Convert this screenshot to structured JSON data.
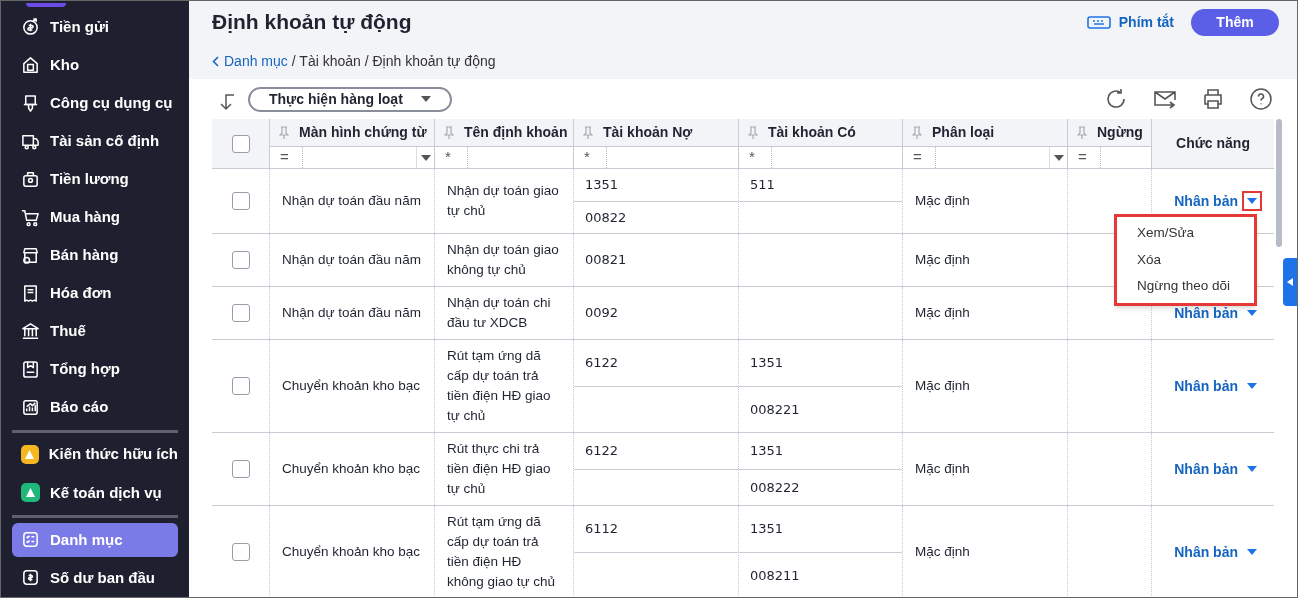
{
  "sidebar": {
    "items": [
      {
        "label": "Tiền gửi",
        "kind": "menu",
        "selected": false
      },
      {
        "label": "Kho",
        "kind": "menu",
        "selected": false
      },
      {
        "label": "Công cụ dụng cụ",
        "kind": "menu",
        "selected": false
      },
      {
        "label": "Tài sản cố định",
        "kind": "menu",
        "selected": false
      },
      {
        "label": "Tiền lương",
        "kind": "menu",
        "selected": false
      },
      {
        "label": "Mua hàng",
        "kind": "menu",
        "selected": false
      },
      {
        "label": "Bán hàng",
        "kind": "menu",
        "selected": false
      },
      {
        "label": "Hóa đơn",
        "kind": "menu",
        "selected": false
      },
      {
        "label": "Thuế",
        "kind": "menu",
        "selected": false
      },
      {
        "label": "Tổng hợp",
        "kind": "menu",
        "selected": false
      },
      {
        "label": "Báo cáo",
        "kind": "menu",
        "selected": false
      },
      {
        "kind": "divider"
      },
      {
        "label": "Kiến thức hữu ích",
        "kind": "app",
        "color": "#f5b71f",
        "selected": false
      },
      {
        "label": "Kế toán dịch vụ",
        "kind": "app",
        "color": "#1fb87a",
        "selected": false
      },
      {
        "kind": "divider"
      },
      {
        "label": "Danh mục",
        "kind": "menu",
        "selected": true
      },
      {
        "label": "Số dư ban đầu",
        "kind": "menu",
        "selected": false
      }
    ]
  },
  "header": {
    "title": "Định khoản tự động",
    "shortcut": "Phím tắt",
    "add_button": "Thêm"
  },
  "breadcrumb": {
    "back": "Danh mục",
    "rest": "/ Tài khoản / Định khoản tự động"
  },
  "toolbar": {
    "bulk_action": "Thực hiện hàng loạt"
  },
  "table": {
    "columns": [
      {
        "label": "Màn hình chứng từ",
        "filter_op": "=",
        "filter_dropdown": true
      },
      {
        "label": "Tên định khoản",
        "filter_op": "*",
        "filter_dropdown": false
      },
      {
        "label": "Tài khoản Nợ",
        "filter_op": "*",
        "filter_dropdown": false
      },
      {
        "label": "Tài khoản Có",
        "filter_op": "*",
        "filter_dropdown": false
      },
      {
        "label": "Phân loại",
        "filter_op": "=",
        "filter_dropdown": true
      },
      {
        "label": "Ngừng",
        "filter_op": "=",
        "filter_dropdown": false
      }
    ],
    "action_column": "Chức năng",
    "all_checked": false,
    "rows": [
      {
        "screen": "Nhận dự toán đầu năm",
        "name": "Nhận dự toán giao tự chủ",
        "debit": [
          "1351",
          "00822"
        ],
        "credit": [
          "511"
        ],
        "category": "Mặc định",
        "action": "Nhân bản",
        "checked": false,
        "menu_open": true
      },
      {
        "screen": "Nhận dự toán đầu năm",
        "name": "Nhận dự toán giao không tự chủ",
        "debit": [
          "00821"
        ],
        "credit": [],
        "category": "Mặc định",
        "checked": false
      },
      {
        "screen": "Nhận dự toán đầu năm",
        "name": "Nhận dự toán chi đầu tư XDCB",
        "debit": [
          "0092"
        ],
        "credit": [],
        "category": "Mặc định",
        "action": "Nhân bản",
        "checked": false,
        "menu_open": false
      },
      {
        "screen": "Chuyển khoản kho bạc",
        "name": "Rút tạm ứng dã cấp dự toán trả tiền điện HĐ giao tự chủ",
        "debit": [
          "6122"
        ],
        "credit": [
          "1351",
          "008221"
        ],
        "category": "Mặc định",
        "action": "Nhân bản",
        "checked": false,
        "menu_open": false
      },
      {
        "screen": "Chuyển khoản kho bạc",
        "name": "Rút thực chi trả tiền điện HĐ giao tự chủ",
        "debit": [
          "6122"
        ],
        "credit": [
          "1351",
          "008222"
        ],
        "category": "Mặc định",
        "action": "Nhân bản",
        "checked": false,
        "menu_open": false
      },
      {
        "screen": "Chuyển khoản kho bạc",
        "name": "Rút tạm ứng dã cấp dự toán trả tiền điện HĐ không giao tự chủ",
        "debit": [
          "6112"
        ],
        "credit": [
          "1351",
          "008211"
        ],
        "category": "Mặc định",
        "action": "Nhân bản",
        "checked": false,
        "menu_open": false
      }
    ]
  },
  "row_menu": {
    "items": [
      "Xem/Sửa",
      "Xóa",
      "Ngừng theo dõi"
    ]
  }
}
